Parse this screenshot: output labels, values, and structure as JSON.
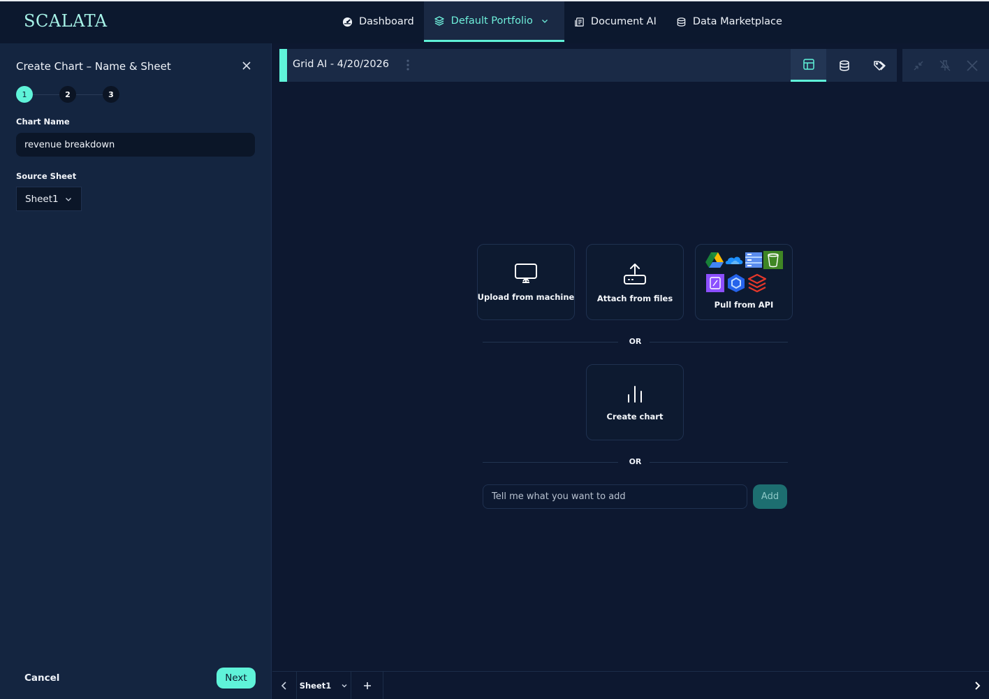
{
  "app": {
    "logo": "SCALATA"
  },
  "nav": {
    "items": [
      {
        "label": "Dashboard",
        "icon": "speedometer-icon"
      },
      {
        "label": "Default Portfolio",
        "icon": "layers-icon",
        "active": true
      },
      {
        "label": "Document AI",
        "icon": "document-icon"
      },
      {
        "label": "Data Marketplace",
        "icon": "database-icon"
      }
    ]
  },
  "panel": {
    "title": "Create Chart – Name & Sheet",
    "steps": [
      "1",
      "2",
      "3"
    ],
    "active_step": 1,
    "chart_name_label": "Chart Name",
    "chart_name_value": "revenue breakdown",
    "source_sheet_label": "Source Sheet",
    "source_sheet_value": "Sheet1",
    "cancel_label": "Cancel",
    "next_label": "Next"
  },
  "tab": {
    "title": "Grid AI - 4/20/2026",
    "views": [
      "table-icon",
      "database-icon",
      "tags-icon"
    ],
    "window_controls": [
      "collapse-icon",
      "unpin-icon",
      "close-icon"
    ]
  },
  "actions": {
    "upload_label": "Upload from machine",
    "attach_label": "Attach from files",
    "api_label": "Pull from API",
    "api_icons": [
      "google-drive-icon",
      "onedrive-icon",
      "storage-icon",
      "s3-bucket-icon",
      "azure-storage-icon",
      "hexagon-icon",
      "databricks-icon"
    ],
    "or_label_1": "OR",
    "create_chart_label": "Create chart",
    "or_label_2": "OR",
    "prompt_placeholder": "Tell me what you want to add",
    "add_label": "Add"
  },
  "sheets": {
    "current": "Sheet1"
  },
  "colors": {
    "accent": "#5ff3d9",
    "background": "#0d1830",
    "panel": "#142540"
  }
}
